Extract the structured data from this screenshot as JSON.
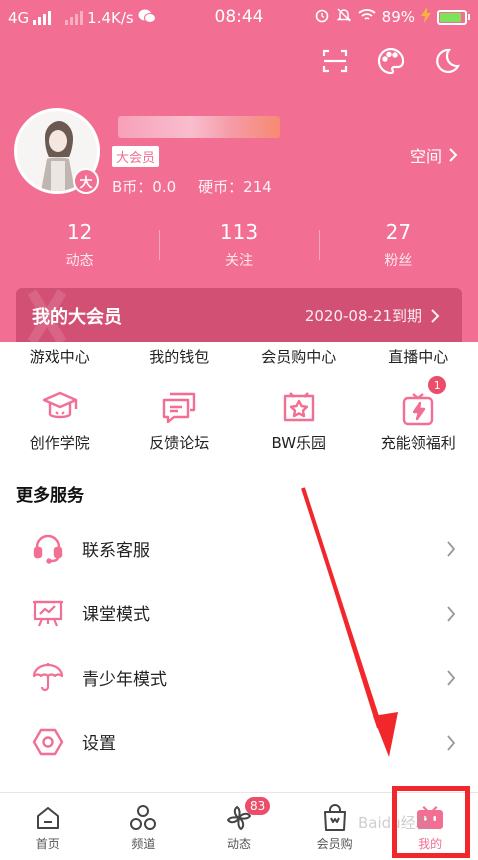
{
  "status_bar": {
    "network": "4G",
    "speed": "1.4K/s",
    "time": "08:44",
    "battery": "89%"
  },
  "colors": {
    "brand_pink": "#F26E93",
    "vip_card": "#D35075",
    "badge_red": "#EC4D6B",
    "annotation_red": "#F2272C"
  },
  "top_icons": [
    "scan-icon",
    "palette-icon",
    "night-mode-icon"
  ],
  "profile": {
    "vip_tag": "大会员",
    "b_coin": "B币：0.0",
    "hard_coin": "硬币：214",
    "space_link": "空间",
    "avatar_badge": "大"
  },
  "stats": [
    {
      "num": "12",
      "label": "动态"
    },
    {
      "num": "113",
      "label": "关注"
    },
    {
      "num": "27",
      "label": "粉丝"
    }
  ],
  "vip_card": {
    "title": "我的大会员",
    "expiry": "2020-08-21到期"
  },
  "menu_row1": [
    "游戏中心",
    "我的钱包",
    "会员购中心",
    "直播中心"
  ],
  "menu_row2": [
    {
      "label": "创作学院",
      "icon": "graduation-cap-icon",
      "badge": ""
    },
    {
      "label": "反馈论坛",
      "icon": "chat-bubbles-icon",
      "badge": ""
    },
    {
      "label": "BW乐园",
      "icon": "star-box-icon",
      "badge": ""
    },
    {
      "label": "充能领福利",
      "icon": "lightning-gift-icon",
      "badge": "1"
    }
  ],
  "more_services": {
    "title": "更多服务",
    "items": [
      {
        "label": "联系客服",
        "icon": "headset-icon"
      },
      {
        "label": "课堂模式",
        "icon": "classroom-board-icon"
      },
      {
        "label": "青少年模式",
        "icon": "umbrella-icon"
      },
      {
        "label": "设置",
        "icon": "settings-hexagon-icon"
      }
    ]
  },
  "bottom_nav": [
    {
      "label": "首页",
      "icon": "home-icon",
      "badge": ""
    },
    {
      "label": "频道",
      "icon": "channel-icon",
      "badge": ""
    },
    {
      "label": "动态",
      "icon": "pinwheel-icon",
      "badge": "83"
    },
    {
      "label": "会员购",
      "icon": "shopping-bag-icon",
      "badge": ""
    },
    {
      "label": "我的",
      "icon": "bilibili-tv-icon",
      "badge": ""
    }
  ],
  "watermark": "Baidu经验"
}
